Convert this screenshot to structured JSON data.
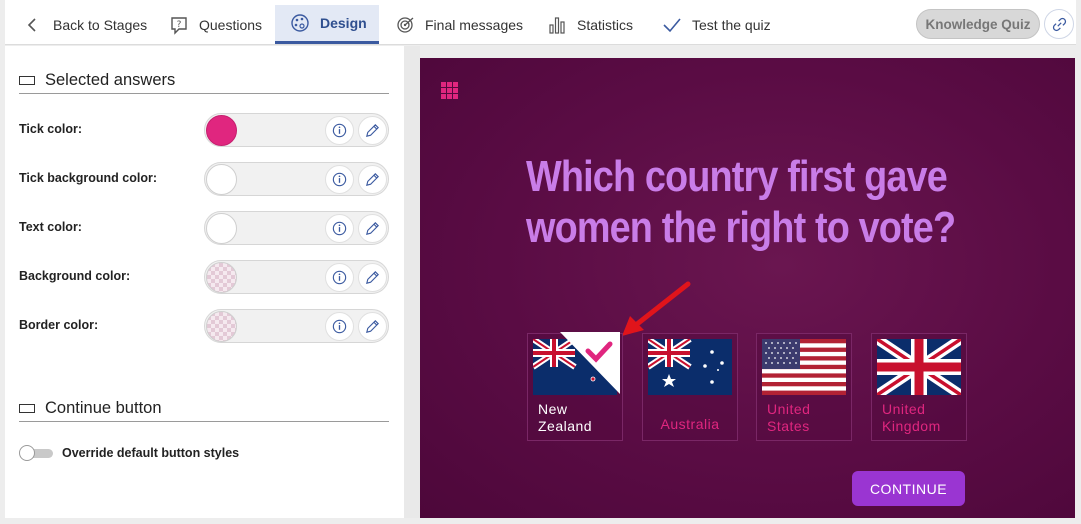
{
  "nav": {
    "back": {
      "label": "Back to Stages",
      "icon": "chevron-left-icon"
    },
    "questions": {
      "label": "Questions",
      "icon": "question-bubble-icon"
    },
    "design": {
      "label": "Design",
      "icon": "palette-icon",
      "active": true
    },
    "final_messages": {
      "label": "Final messages",
      "icon": "target-icon"
    },
    "statistics": {
      "label": "Statistics",
      "icon": "bar-chart-icon"
    },
    "test": {
      "label": "Test the quiz",
      "icon": "checkmark-icon"
    },
    "quiz_name": "Knowledge Quiz",
    "link_icon": "link-icon"
  },
  "settings": {
    "selected_answers_title": "Selected answers",
    "rows": [
      {
        "label": "Tick color:",
        "swatch": "#e0267f"
      },
      {
        "label": "Tick background color:",
        "swatch": "#ffffff"
      },
      {
        "label": "Text color:",
        "swatch": "#ffffff"
      },
      {
        "label": "Background color:",
        "swatch": "transparent"
      },
      {
        "label": "Border color:",
        "swatch": "transparent"
      }
    ],
    "continue_title": "Continue button",
    "override_label": "Override default button styles",
    "override_enabled": false
  },
  "preview": {
    "question": "Which country first gave women the right to vote?",
    "answers": [
      {
        "name": "New Zealand",
        "selected": true
      },
      {
        "name": "Australia",
        "selected": false
      },
      {
        "name": "United States",
        "selected": false
      },
      {
        "name": "United Kingdom",
        "selected": false
      }
    ],
    "continue_label": "CONTINUE",
    "colors": {
      "question": "#c97de8",
      "accent": "#e0267f",
      "button": "#9a35d2",
      "background": "#5a0c44"
    }
  }
}
